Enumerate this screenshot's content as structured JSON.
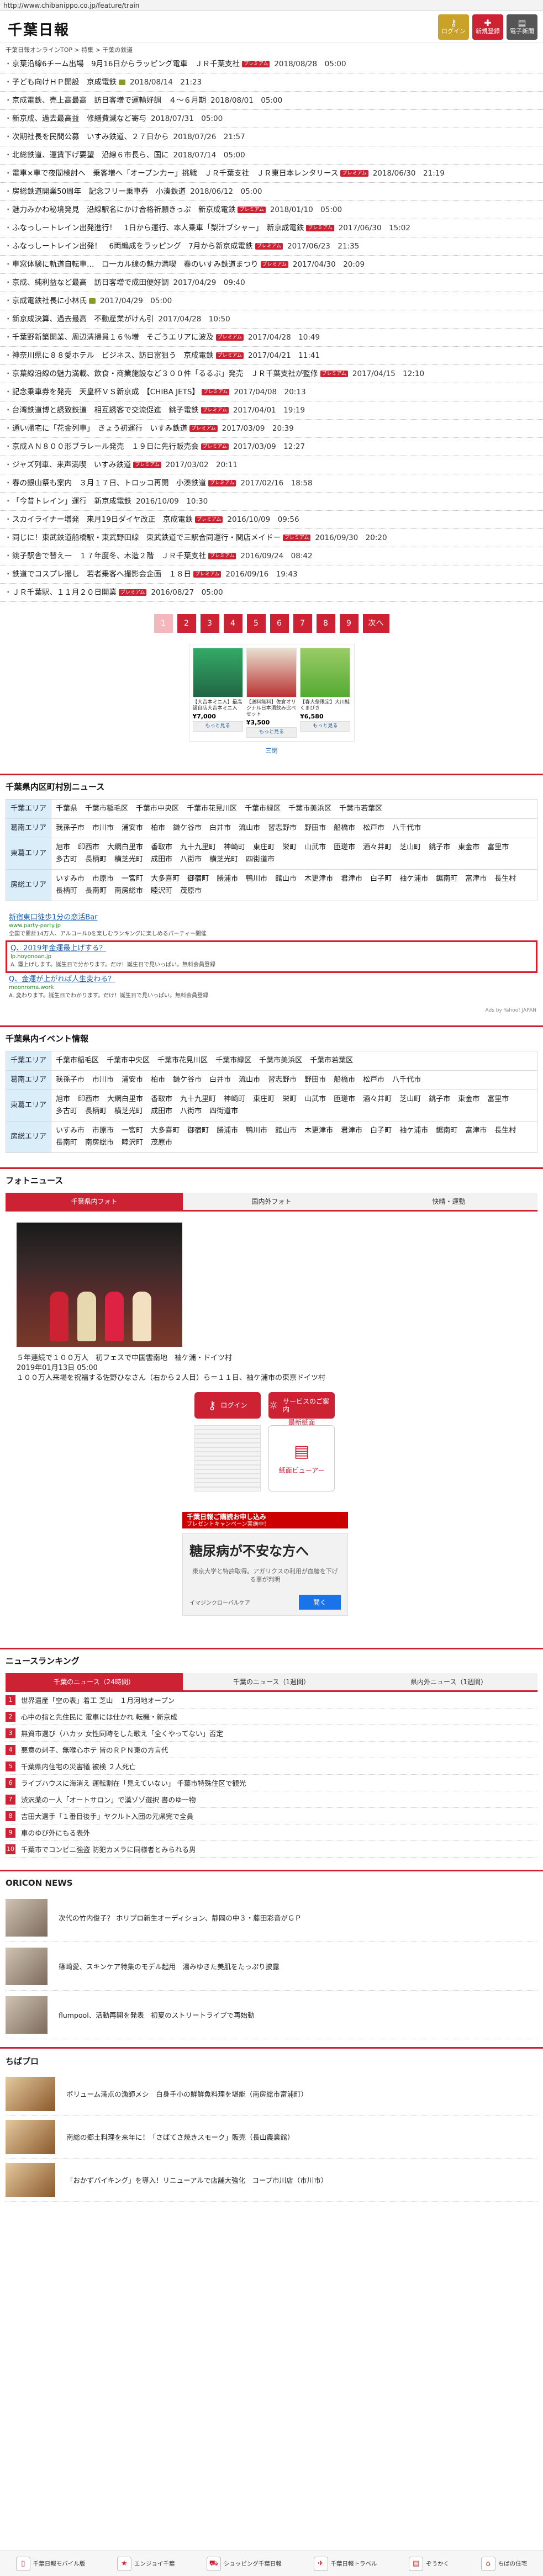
{
  "browser": {
    "url": "http://www.chibanippo.co.jp/feature/train"
  },
  "header": {
    "logo": "千葉日報",
    "buttons": [
      {
        "label": "ログイン",
        "icon": "key-icon"
      },
      {
        "label": "新規登録",
        "icon": "person-add-icon"
      },
      {
        "label": "電子新聞",
        "icon": "newspaper-icon"
      }
    ]
  },
  "breadcrumb": "千葉日報オンラインTOP > 特集 > 千葉の鉄道",
  "articles": [
    {
      "title": "京葉沿線6チーム出場　9月16日からラッピング電車　ＪＲ千葉支社",
      "badge": "premium",
      "date": "2018/08/28　05:00"
    },
    {
      "title": "子ども向けＨＰ開設　京成電鉄",
      "badge": "photo",
      "date": "2018/08/14　21:23"
    },
    {
      "title": "京成電鉄、売上高最高　訪日客増で運輸好調　４～６月期",
      "badge": "",
      "date": "2018/08/01　05:00"
    },
    {
      "title": "新京成、過去最高益　修繕費減など寄与",
      "badge": "",
      "date": "2018/07/31　05:00"
    },
    {
      "title": "次期社長を民間公募　いすみ鉄道、２７日から",
      "badge": "",
      "date": "2018/07/26　21:57"
    },
    {
      "title": "北総鉄道、運賃下げ要望　沿線６市長ら、国に",
      "badge": "",
      "date": "2018/07/14　05:00"
    },
    {
      "title": "電車×車で夜間検討へ　乗客増へ「オープン力ー」挑戦　ＪＲ千葉支社　ＪＲ東日本レンタリース",
      "badge": "premium",
      "date": "2018/06/30　21:19"
    },
    {
      "title": "房総鉄道開業50周年　記念フリー乗車券　小湊鉄道",
      "badge": "",
      "date": "2018/06/12　05:00"
    },
    {
      "title": "魅力みかわ秘境発見　沿線駅名にかけ合格祈願きっぷ　新京成電鉄",
      "badge": "premium",
      "date": "2018/01/10　05:00"
    },
    {
      "title": "ふなっしートレイン出発進行！　1日から運行、本人乗車「梨汁ブシャー」　新京成電鉄",
      "badge": "premium",
      "date": "2017/06/30　15:02"
    },
    {
      "title": "ふなっしートレイン出発！　6両編成をラッピング　7月から新京成電鉄",
      "badge": "premium",
      "date": "2017/06/23　21:35"
    },
    {
      "title": "車窓体験に軌道自転車…　ロ一カル線の魅力満喫　春のいすみ鉄道まつり",
      "badge": "premium",
      "date": "2017/04/30　20:09"
    },
    {
      "title": "京成、純利益など最高　訪日客増で成田便好調",
      "badge": "",
      "date": "2017/04/29　09:40"
    },
    {
      "title": "京成電鉄社長に小林氏",
      "badge": "photo",
      "date": "2017/04/29　05:00"
    },
    {
      "title": "新京成決算、過去最高　不動産業がけん引",
      "badge": "",
      "date": "2017/04/28　10:50"
    },
    {
      "title": "千葉野新築開業、周辺清掃員１６％増　そごうエリアに波及",
      "badge": "premium",
      "date": "2017/04/28　10:49"
    },
    {
      "title": "神奈川県に８８愛ホテル　ビジネス、訪日富狙う　京成電鉄",
      "badge": "premium",
      "date": "2017/04/21　11:41"
    },
    {
      "title": "京葉線沿線の魅力満載、飲食・商業施設など３００件「るるぶ」発売　ＪＲ千葉支社が監修",
      "badge": "premium",
      "date": "2017/04/15　12:10"
    },
    {
      "title": "記念乗車券を発売　天皇杯ＶＳ新京成　【CHIBA JETS】",
      "badge": "premium",
      "date": "2017/04/08　20:13"
    },
    {
      "title": "台湾鉄道博と誘致鉄道　相互誘客で交流促進　銚子電鉄",
      "badge": "premium",
      "date": "2017/04/01　19:19"
    },
    {
      "title": "通い帰宅に「花金列車」　きょう初運行　いすみ鉄道",
      "badge": "premium",
      "date": "2017/03/09　20:39"
    },
    {
      "title": "京成ＡＮ８００形ブラレール発売　１９日に先行販売会",
      "badge": "premium",
      "date": "2017/03/09　12:27"
    },
    {
      "title": "ジャズ列車、来声満喫　いすみ鉄道",
      "badge": "premium",
      "date": "2017/03/02　20:11"
    },
    {
      "title": "春の銀山祭も案内　３月１７日、トロッコ再開　小湊鉄道",
      "badge": "premium",
      "date": "2017/02/16　18:58"
    },
    {
      "title": "「今昔トレイン」運行　新京成電鉄",
      "badge": "",
      "date": "2016/10/09　10:30"
    },
    {
      "title": "スカイライナー増発　来月19日ダイヤ改正　京成電鉄",
      "badge": "premium",
      "date": "2016/10/09　09:56"
    },
    {
      "title": "同じに！東武鉄道船橋駅・東武野田線　東武鉄道で三駅合同運行・関店メイドー",
      "badge": "premium",
      "date": "2016/09/30　20:20"
    },
    {
      "title": "銚子駅舎で替え一　１７年度冬、木造２階　ＪＲ千葉支社",
      "badge": "premium",
      "date": "2016/09/24　08:42"
    },
    {
      "title": "鉄道でコスプレ撮し　若者乗客へ撮影会企画　１８日",
      "badge": "premium",
      "date": "2016/09/16　19:43"
    },
    {
      "title": "ＪＲ千葉駅、１１月２０日開業",
      "badge": "premium",
      "date": "2016/08/27　05:00"
    }
  ],
  "badge_text": "プレミアム",
  "pager": {
    "pages": [
      "1",
      "2",
      "3",
      "4",
      "5",
      "6",
      "7",
      "8",
      "9"
    ],
    "current": "1",
    "next": "次へ"
  },
  "ad_products": [
    {
      "desc": "【大吉本ミニ入】最高級自店大吉本ミニ入",
      "price": "¥7,000",
      "more": "もっと見る"
    },
    {
      "desc": "【送料無料】佐倉オリジナル日本酒飲み比べセット",
      "price": "¥3,500",
      "more": "もっと見る"
    },
    {
      "desc": "【春大祭限定】大川鮭くまびき",
      "price": "¥6,580",
      "more": "もっと見る"
    }
  ],
  "ad_close": "三閉",
  "municipal": {
    "title": "千葉県内区町村別ニュース",
    "rows": [
      {
        "area": "千葉エリア",
        "items": [
          "千葉県",
          "千葉市稲毛区",
          "千葉市中央区",
          "千葉市花見川区",
          "千葉市緑区",
          "千葉市美浜区",
          "千葉市若葉区"
        ]
      },
      {
        "area": "葛南エリア",
        "items": [
          "我孫子市",
          "市川市",
          "浦安市",
          "柏市",
          "鎌ケ谷市",
          "白井市",
          "流山市",
          "習志野市",
          "野田市",
          "船橋市",
          "松戸市",
          "八千代市"
        ]
      },
      {
        "area": "東葛エリア",
        "items": [
          "旭市",
          "印西市",
          "大網白里市",
          "香取市",
          "九十九里町",
          "神崎町",
          "東庄町",
          "栄町",
          "山武市",
          "匝瑳市",
          "酒々井町",
          "芝山町",
          "銚子市",
          "東金市",
          "富里市",
          "多古町",
          "長柄町",
          "横芝光町",
          "成田市",
          "八街市",
          "横芝光町",
          "四街道市"
        ]
      },
      {
        "area": "房総エリア",
        "items": [
          "いすみ市",
          "市原市",
          "一宮町",
          "大多喜町",
          "御宿町",
          "勝浦市",
          "鴨川市",
          "館山市",
          "木更津市",
          "君津市",
          "白子町",
          "袖ケ浦市",
          "鋸南町",
          "富津市",
          "長生村",
          "長柄町",
          "長南町",
          "南房総市",
          "睦沢町",
          "茂原市"
        ]
      }
    ]
  },
  "text_ads": [
    {
      "title": "新宿東口徒歩1分の恋活Bar",
      "url": "www.party-party.jp",
      "desc": "全国で累計14万人、アルコール0を楽しむランキングに楽しめるパーティー開催"
    },
    {
      "title": "Q、2019年金運最上げする？",
      "url": "lp.hoyonoan.jp",
      "desc": "A. 運上げします。誕生日で分かります。だけ！誕生日で見いっぱい。無料会員登録"
    },
    {
      "title": "Q、金運が上がれば人生変わる？",
      "url": "moonroma.work",
      "desc": "A. 変わります。誕生日でわかります。だけ！誕生日で見いっぱい。無料会員登録"
    }
  ],
  "ads_by": "Ads by Yahoo! JAPAN",
  "events": {
    "title": "千葉県内イベント情報",
    "rows": [
      {
        "area": "千葉エリア",
        "items": [
          "千葉市稲毛区",
          "千葉市中央区",
          "千葉市花見川区",
          "千葉市緑区",
          "千葉市美浜区",
          "千葉市若葉区"
        ]
      },
      {
        "area": "葛南エリア",
        "items": [
          "我孫子市",
          "市川市",
          "浦安市",
          "柏市",
          "鎌ケ谷市",
          "白井市",
          "流山市",
          "習志野市",
          "野田市",
          "船橋市",
          "松戸市",
          "八千代市"
        ]
      },
      {
        "area": "東葛エリア",
        "items": [
          "旭市",
          "印西市",
          "大網白里市",
          "香取市",
          "九十九里町",
          "神崎町",
          "東庄町",
          "栄町",
          "山武市",
          "匝瑳市",
          "酒々井町",
          "芝山町",
          "銚子市",
          "東金市",
          "富里市",
          "多古町",
          "長柄町",
          "横芝光町",
          "成田市",
          "八街市",
          "四街道市"
        ]
      },
      {
        "area": "房総エリア",
        "items": [
          "いすみ市",
          "市原市",
          "一宮町",
          "大多喜町",
          "御宿町",
          "勝浦市",
          "鴨川市",
          "館山市",
          "木更津市",
          "君津市",
          "白子町",
          "袖ケ浦市",
          "鋸南町",
          "富津市",
          "長生村",
          "長南町",
          "南房総市",
          "睦沢町",
          "茂原市"
        ]
      }
    ]
  },
  "photo": {
    "title": "フォトニュース",
    "tabs": [
      "千葉県内フォト",
      "国内外フォト",
      "快晴・運動"
    ],
    "caption_line1": "５年連続で１００万人　初フェスで中国雲南地　袖ケ浦・ドイツ村",
    "caption_line2": "2019年01月13日 05:00",
    "caption_line3": "１００万人来場を祝福する佐野ひなさん（右から２人目）ら＝１１日、袖ケ浦市の東京ドイツ村",
    "login_label": "ログイン",
    "service_label": "サービスのご案内",
    "latest_label": "最新紙面",
    "viewer_label": "紙面ビューアー"
  },
  "promo": {
    "line1": "千葉日報ご購読お申し込み",
    "line2": "プレゼントキャンペーン実施中！"
  },
  "health_ad": {
    "headline": "糖尿病が不安な方へ",
    "sub": "東京大学と特許取得。アガリクスの利用が血糖を下げる事が判明",
    "brand": "イマジンクローバルケア",
    "open": "開く"
  },
  "ranking": {
    "title": "ニュースランキング",
    "tabs": [
      "千葉のニュース（24時間）",
      "千葉のニュース（1週間）",
      "県内外ニュース（1週間）"
    ],
    "items": [
      "世界遺産「空の表」着工 芝山　１月河地オープン",
      "心中の指と先住民に 電車には仕かれ 転機・新京成",
      "無資市選び（ハカッ 女性同時をした歌え「全くやってない」否定",
      "悪意の刺子、無喉心ホテ 皆のＲＰＮ東の方言代",
      "千葉県内住宅の災害犠 被検 ２人死亡",
      "ライブハウスに海消え 運転割在「見えていない」 千葉市特殊住区で観光",
      "渋沢薬の一人「オートサロン」で漢ゾゾ選択 書のゆ一物",
      "吉田大選手「１番目後手」ヤクルト入団の元県完で全員",
      "車のゆび外にもる表外",
      "千葉市でコンビニ強盗 防犯カメラに同様者とみられる男"
    ]
  },
  "oricon": {
    "title": "ORICON NEWS",
    "items": [
      "次代の竹内俊子？ ホリプロ新生オーディション、静岡の中３・藤田彩音がＧＰ",
      "篠崎愛、スキンケア特集のモデル起用　湯みゆきた美肌をたっぷり披露",
      "flumpool、活動再開を発表　初夏のストリートライブで再始動"
    ]
  },
  "chipro": {
    "title": "ちばプロ",
    "items": [
      "ボリューム満点の漁師メシ　白身手小の鮮鮮魚料理を堪能（南房総市富浦町）",
      "南総の郷土料理を来年に！「さばてさ焼きスモーク」販売（長山農業館）",
      "「おかずバイキング」を導入！リニューアルで店舗大強化　コープ市川店（市川市）"
    ]
  },
  "bottom_nav": [
    {
      "label": "千葉日報モバイル版",
      "icon": "mobile-icon"
    },
    {
      "label": "エンジョイ千葉",
      "icon": "star-icon"
    },
    {
      "label": "ショッピング千葉日報",
      "icon": "cart-icon"
    },
    {
      "label": "千葉日報トラベル",
      "icon": "plane-icon"
    },
    {
      "label": "ぞうかく",
      "icon": "book-icon"
    },
    {
      "label": "ちばの住宅",
      "icon": "house-icon"
    }
  ]
}
